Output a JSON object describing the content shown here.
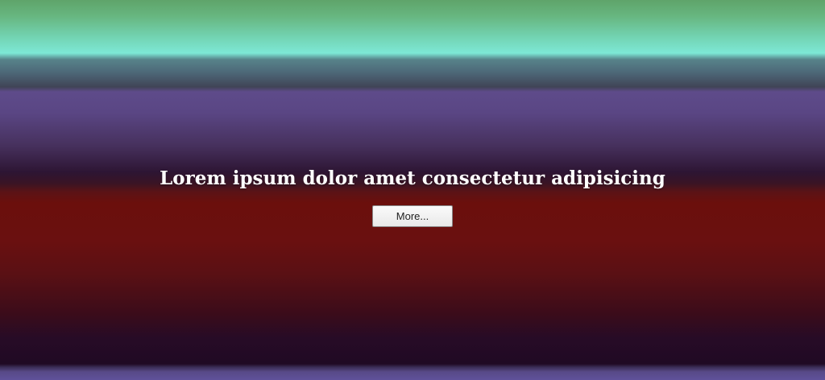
{
  "hero": {
    "title": "Lorem ipsum dolor amet consectetur adipisicing",
    "button_label": "More..."
  },
  "colors": {
    "band_green": "#5fa46a",
    "band_cyan": "#7de8d6",
    "band_purple": "#5e4b8a",
    "band_dark": "#2d1533",
    "band_red": "#6b0f0c",
    "band_bottom_purple": "#5f519a",
    "title_text": "#ffffff"
  }
}
